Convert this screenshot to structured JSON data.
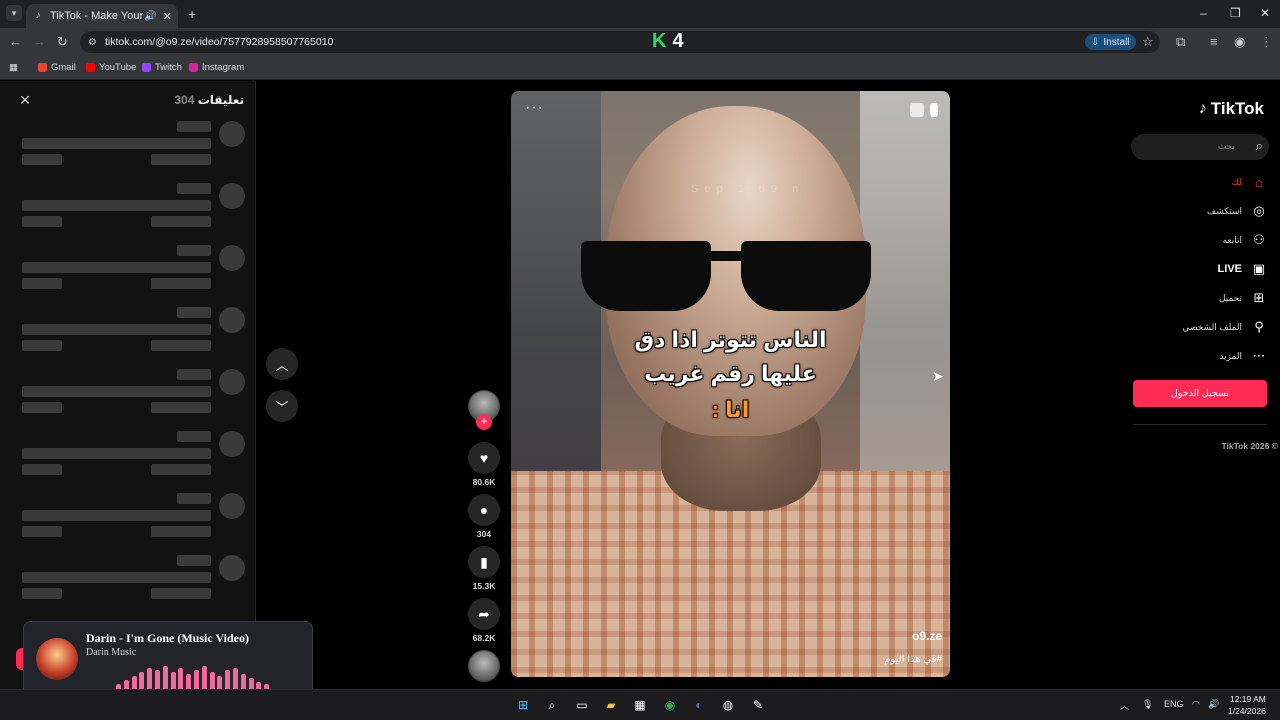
{
  "browser": {
    "tab_title": "TikTok - Make Your Day",
    "url": "tiktok.com/@o9.ze/video/7577928958507765010",
    "install_label": "Install",
    "overlay_badge": "4",
    "bookmarks": [
      "Gmail",
      "YouTube",
      "Twitch",
      "Instagram"
    ]
  },
  "comments": {
    "title": "تعليقات",
    "count": "304"
  },
  "video": {
    "caption_line1": "الناس تتوتر اذا دق",
    "caption_line2": "عليها رقم غريب",
    "caption_line3": "انا :",
    "username": "o9.ze",
    "hashtag": "#في هذا اليوم",
    "watermark": "Sep 1 69 n"
  },
  "actions": {
    "likes": "80.6K",
    "comments": "304",
    "saves": "15.3K",
    "shares": "68.2K"
  },
  "sidebar": {
    "logo": "TikTok",
    "search_placeholder": "بحث",
    "items": [
      {
        "label": "لك",
        "icon": "home-icon"
      },
      {
        "label": "استكشف",
        "icon": "compass-icon"
      },
      {
        "label": "اتابعه",
        "icon": "following-icon"
      },
      {
        "label": "LIVE",
        "icon": "live-icon"
      },
      {
        "label": "تحميل",
        "icon": "upload-icon"
      },
      {
        "label": "الملف الشخصي",
        "icon": "profile-icon"
      },
      {
        "label": "المزيد",
        "icon": "more-icon"
      }
    ],
    "login_label": "تسجيل الدخول",
    "copyright": "TikTok 2026 ©"
  },
  "media_player": {
    "title": "Darin - I'm Gone (Music Video)",
    "artist": "Darin Music"
  },
  "taskbar": {
    "lang": "ENG",
    "time": "12:19 AM",
    "date": "1/24/2026"
  },
  "colors": {
    "accent": "#fe2c55",
    "caption_highlight": "#ff9a2e"
  }
}
